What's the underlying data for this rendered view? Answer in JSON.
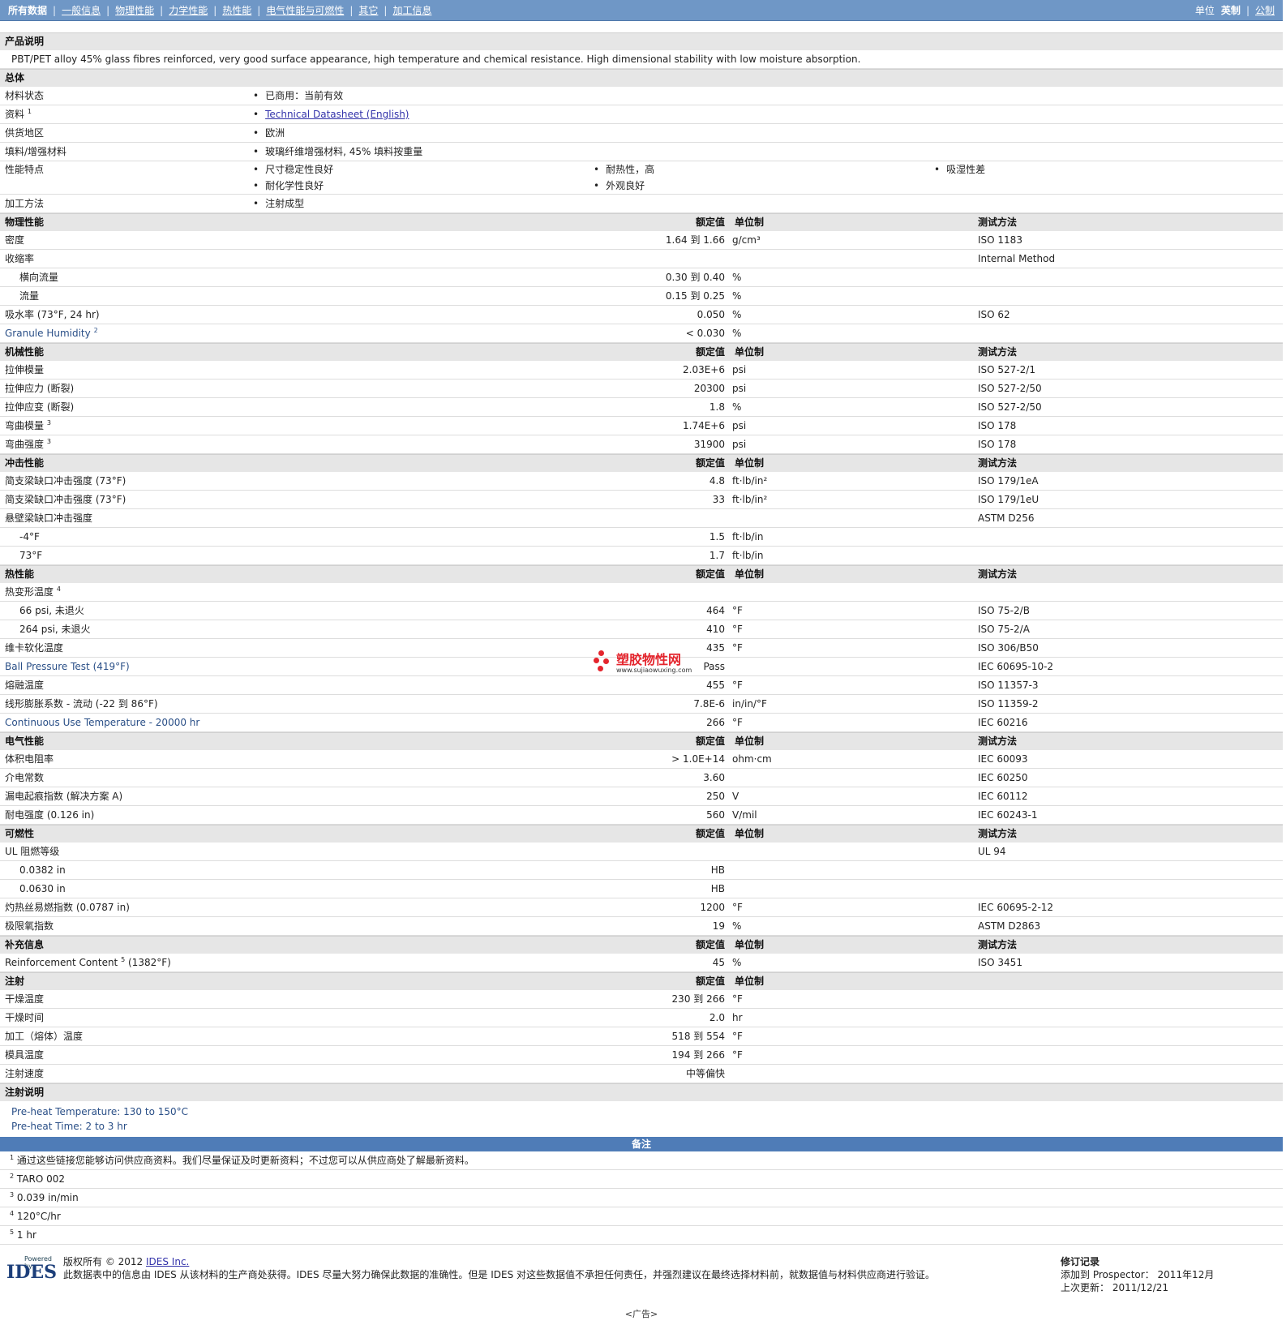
{
  "nav": {
    "items": [
      "所有数据",
      "一般信息",
      "物理性能",
      "力学性能",
      "热性能",
      "电气性能与可燃性",
      "其它",
      "加工信息"
    ],
    "right_label": "单位",
    "units": [
      "英制",
      "公制"
    ]
  },
  "sections": {
    "product_desc": "产品说明",
    "product_text": "PBT/PET alloy 45% glass fibres reinforced, very good surface appearance, high temperature and chemical resistance. High dimensional stability with low moisture absorption.",
    "general": "总体",
    "physical": "物理性能",
    "mechanical": "机械性能",
    "impact": "冲击性能",
    "thermal": "热性能",
    "electrical": "电气性能",
    "flammability": "可燃性",
    "supplemental": "补充信息",
    "injection": "注射",
    "injection_notes": "注射说明",
    "notes": "备注"
  },
  "headers": {
    "nominal": "额定值",
    "unit": "单位制",
    "method": "测试方法"
  },
  "general": {
    "material_status_label": "材料状态",
    "material_status": "已商用：当前有效",
    "docs_label": "资料",
    "docs_sup": "1",
    "docs_link": "Technical Datasheet (English)",
    "region_label": "供货地区",
    "region": "欧洲",
    "filler_label": "填料/增强材料",
    "filler": "玻璃纤维增强材料, 45% 填料按重量",
    "features_label": "性能特点",
    "features": [
      "尺寸稳定性良好",
      "耐热性，高",
      "吸湿性差",
      "耐化学性良好",
      "外观良好"
    ],
    "process_label": "加工方法",
    "process": "注射成型"
  },
  "physical": [
    {
      "label": "密度",
      "value": "1.64 到  1.66",
      "unit": "g/cm³",
      "method": "ISO 1183",
      "cls": ""
    },
    {
      "label": "收缩率",
      "value": "",
      "unit": "",
      "method": "Internal Method",
      "cls": ""
    },
    {
      "label": "横向流量",
      "value": "0.30 到  0.40",
      "unit": "%",
      "method": "",
      "cls": "sub"
    },
    {
      "label": "流量",
      "value": "0.15 到  0.25",
      "unit": "%",
      "method": "",
      "cls": "sub"
    },
    {
      "label": "吸水率  (73°F, 24 hr)",
      "value": "0.050",
      "unit": "%",
      "method": "ISO 62",
      "cls": ""
    },
    {
      "label": "Granule Humidity",
      "sup": "2",
      "value": "< 0.030",
      "unit": "%",
      "method": "",
      "cls": "blue"
    }
  ],
  "mechanical": [
    {
      "label": "拉伸模量",
      "value": "2.03E+6",
      "unit": "psi",
      "method": "ISO 527-2/1"
    },
    {
      "label": "拉伸应力  (断裂)",
      "value": "20300",
      "unit": "psi",
      "method": "ISO 527-2/50"
    },
    {
      "label": "拉伸应变  (断裂)",
      "value": "1.8",
      "unit": "%",
      "method": "ISO 527-2/50"
    },
    {
      "label": "弯曲模量",
      "sup": "3",
      "value": "1.74E+6",
      "unit": "psi",
      "method": "ISO 178"
    },
    {
      "label": "弯曲强度",
      "sup": "3",
      "value": "31900",
      "unit": "psi",
      "method": "ISO 178"
    }
  ],
  "impact": [
    {
      "label": "简支梁缺口冲击强度  (73°F)",
      "value": "4.8",
      "unit": "ft·lb/in²",
      "method": "ISO 179/1eA",
      "cls": ""
    },
    {
      "label": "简支梁缺口冲击强度  (73°F)",
      "value": "33",
      "unit": "ft·lb/in²",
      "method": "ISO 179/1eU",
      "cls": ""
    },
    {
      "label": "悬壁梁缺口冲击强度",
      "value": "",
      "unit": "",
      "method": "ASTM D256",
      "cls": ""
    },
    {
      "label": "-4°F",
      "value": "1.5",
      "unit": "ft·lb/in",
      "method": "",
      "cls": "sub"
    },
    {
      "label": "73°F",
      "value": "1.7",
      "unit": "ft·lb/in",
      "method": "",
      "cls": "sub"
    }
  ],
  "thermal": [
    {
      "label": "热变形温度",
      "sup": "4",
      "value": "",
      "unit": "",
      "method": "",
      "cls": ""
    },
    {
      "label": "66 psi, 未退火",
      "value": "464",
      "unit": "°F",
      "method": "ISO 75-2/B",
      "cls": "sub"
    },
    {
      "label": "264 psi, 未退火",
      "value": "410",
      "unit": "°F",
      "method": "ISO 75-2/A",
      "cls": "sub"
    },
    {
      "label": "维卡软化温度",
      "value": "435",
      "unit": "°F",
      "method": "ISO 306/B50",
      "cls": ""
    },
    {
      "label": "Ball Pressure Test (419°F)",
      "value": "Pass",
      "unit": "",
      "method": "IEC 60695-10-2",
      "cls": "blue"
    },
    {
      "label": "熔融温度",
      "value": "455",
      "unit": "°F",
      "method": "ISO 11357-3",
      "cls": ""
    },
    {
      "label": "线形膨胀系数  - 流动  (-22 到  86°F)",
      "value": "7.8E-6",
      "unit": "in/in/°F",
      "method": "ISO 11359-2",
      "cls": ""
    },
    {
      "label": "Continuous Use Temperature - 20000 hr",
      "value": "266",
      "unit": "°F",
      "method": "IEC 60216",
      "cls": "blue"
    }
  ],
  "electrical": [
    {
      "label": "体积电阻率",
      "value": "> 1.0E+14",
      "unit": "ohm·cm",
      "method": "IEC 60093"
    },
    {
      "label": "介电常数",
      "value": "3.60",
      "unit": "",
      "method": "IEC 60250"
    },
    {
      "label": "漏电起痕指数  (解决方案  A)",
      "value": "250",
      "unit": "V",
      "method": "IEC 60112"
    },
    {
      "label": "耐电强度  (0.126 in)",
      "value": "560",
      "unit": "V/mil",
      "method": "IEC 60243-1"
    }
  ],
  "flammability": [
    {
      "label": "UL 阻燃等级",
      "value": "",
      "unit": "",
      "method": "UL 94",
      "cls": ""
    },
    {
      "label": "0.0382 in",
      "value": "HB",
      "unit": "",
      "method": "",
      "cls": "sub"
    },
    {
      "label": "0.0630 in",
      "value": "HB",
      "unit": "",
      "method": "",
      "cls": "sub"
    },
    {
      "label": "灼热丝易燃指数  (0.0787 in)",
      "value": "1200",
      "unit": "°F",
      "method": "IEC 60695-2-12",
      "cls": ""
    },
    {
      "label": "极限氧指数",
      "value": "19",
      "unit": "%",
      "method": "ASTM D2863",
      "cls": ""
    }
  ],
  "supplemental": [
    {
      "label": "Reinforcement Content",
      "sup": "5",
      "suffix": " (1382°F)",
      "value": "45",
      "unit": "%",
      "method": "ISO 3451"
    }
  ],
  "injection": [
    {
      "label": "干燥温度",
      "value": "230 到  266",
      "unit": "°F"
    },
    {
      "label": "干燥时间",
      "value": "2.0",
      "unit": "hr"
    },
    {
      "label": "加工（熔体）温度",
      "value": "518 到  554",
      "unit": "°F"
    },
    {
      "label": "模具温度",
      "value": "194 到  266",
      "unit": "°F"
    },
    {
      "label": "注射速度",
      "value": "中等偏快",
      "unit": ""
    }
  ],
  "injection_notes": [
    "Pre-heat Temperature: 130 to 150°C",
    "Pre-heat Time: 2 to 3 hr"
  ],
  "notes": [
    {
      "n": "1",
      "text": "通过这些链接您能够访问供应商资料。我们尽量保证及时更新资料；不过您可以从供应商处了解最新资料。"
    },
    {
      "n": "2",
      "text": "TARO 002"
    },
    {
      "n": "3",
      "text": "0.039 in/min"
    },
    {
      "n": "4",
      "text": "120°C/hr"
    },
    {
      "n": "5",
      "text": "1 hr"
    }
  ],
  "footer": {
    "powered": "Powered by",
    "logo": "IDES",
    "copyright": "版权所有 © 2012",
    "company_link": "IDES Inc.",
    "disclaimer": "此数据表中的信息由  IDES 从该材料的生产商处获得。IDES 尽量大努力确保此数据的准确性。但是  IDES 对这些数据值不承担任何责任，并强烈建议在最终选择材料前，就数据值与材料供应商进行验证。",
    "rev_title": "修订记录",
    "added_label": "添加到  Prospector：",
    "added_value": "2011年12月",
    "updated_label": "上次更新：",
    "updated_value": "2011/12/21",
    "ad": "<广告>"
  },
  "watermark": {
    "cn": "塑胶物性网",
    "url": "www.sujiaowuxing.com",
    "color": "#e4252d"
  }
}
